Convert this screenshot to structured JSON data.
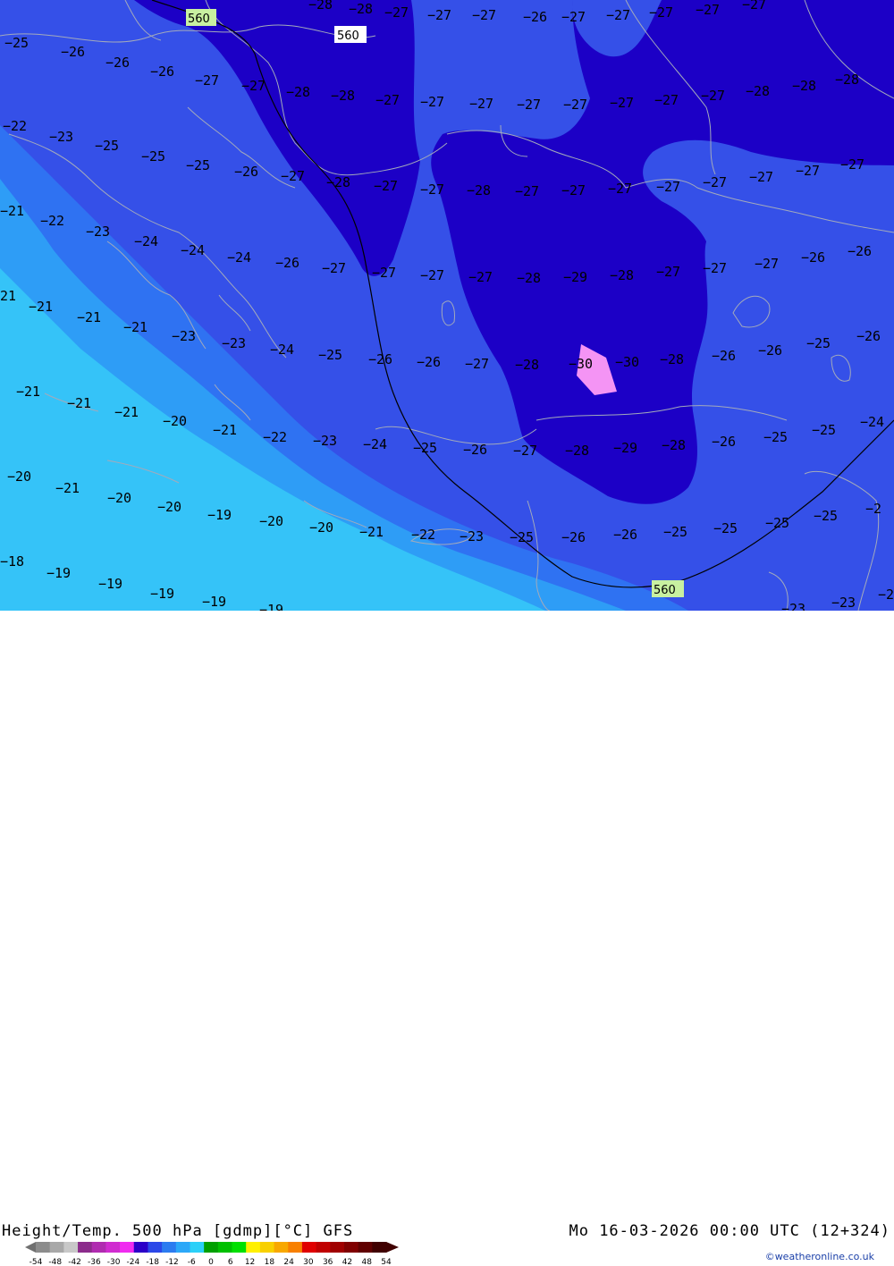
{
  "map": {
    "colors": {
      "band_m20": "#35c3f8",
      "band_m22": "#2e9df6",
      "band_m24": "#2f72f2",
      "band_m26": "#3550e8",
      "band_m28": "#1c00c6",
      "band_m30": "#f494f4",
      "coast": "#a3aabb"
    },
    "height_contours": [
      {
        "label": "560"
      },
      {
        "label": "560"
      },
      {
        "label": "560"
      }
    ],
    "temperature_labels": [
      "-28",
      "-28",
      "-27",
      "-27",
      "-27",
      "-26",
      "-27",
      "-27",
      "-27",
      "-27",
      "-27",
      "-25",
      "-26",
      "-26",
      "-26",
      "-27",
      "-27",
      "-28",
      "-28",
      "-27",
      "-27",
      "-27",
      "-27",
      "-27",
      "-27",
      "-27",
      "-27",
      "-28",
      "-28",
      "-28",
      "-22",
      "-23",
      "-25",
      "-25",
      "-25",
      "-26",
      "-27",
      "-28",
      "-27",
      "-27",
      "-28",
      "-27",
      "-27",
      "-27",
      "-27",
      "-27",
      "-27",
      "-27",
      "-27",
      "-21",
      "-22",
      "-23",
      "-24",
      "-24",
      "-24",
      "-26",
      "-27",
      "-27",
      "-27",
      "-27",
      "-28",
      "-29",
      "-28",
      "-27",
      "-27",
      "-27",
      "-26",
      "-26",
      "21",
      "-21",
      "-21",
      "-21",
      "-23",
      "-23",
      "-24",
      "-25",
      "-26",
      "-26",
      "-27",
      "-28",
      "-30",
      "-30",
      "-28",
      "-26",
      "-26",
      "-25",
      "-26",
      "-21",
      "-21",
      "-21",
      "-20",
      "-21",
      "-22",
      "-23",
      "-24",
      "-25",
      "-26",
      "-27",
      "-28",
      "-29",
      "-28",
      "-26",
      "-25",
      "-25",
      "-24",
      "-20",
      "-21",
      "-20",
      "-20",
      "-19",
      "-20",
      "-20",
      "-21",
      "-22",
      "-23",
      "-25",
      "-26",
      "-26",
      "-25",
      "-25",
      "-25",
      "-25",
      "-2",
      "-18",
      "-19",
      "-19",
      "-19",
      "-19",
      "-19",
      "-23",
      "-23",
      "-2"
    ]
  },
  "footer": {
    "title_left": "Height/Temp. 500 hPa [gdmp][°C] GFS",
    "title_right": "Mo 16-03-2026 00:00 UTC (12+324)",
    "credit": "©weatheronline.co.uk"
  },
  "colorbar": {
    "ticks": [
      "-54",
      "-48",
      "-42",
      "-36",
      "-30",
      "-24",
      "-18",
      "-12",
      "-6",
      "0",
      "6",
      "12",
      "18",
      "24",
      "30",
      "36",
      "42",
      "48",
      "54"
    ],
    "colors": [
      "#8c8c8c",
      "#a8a8a8",
      "#c8c8c8",
      "#8c2c8c",
      "#b02cb0",
      "#d02cd0",
      "#f02cf0",
      "#2c00c8",
      "#2c48e8",
      "#2c7cf0",
      "#2ca8f8",
      "#2cd0f8",
      "#00a000",
      "#00c000",
      "#00e000",
      "#fff000",
      "#f8d000",
      "#f8a800",
      "#f88000",
      "#e00000",
      "#c00000",
      "#a00000",
      "#800000",
      "#600000",
      "#400000"
    ]
  }
}
